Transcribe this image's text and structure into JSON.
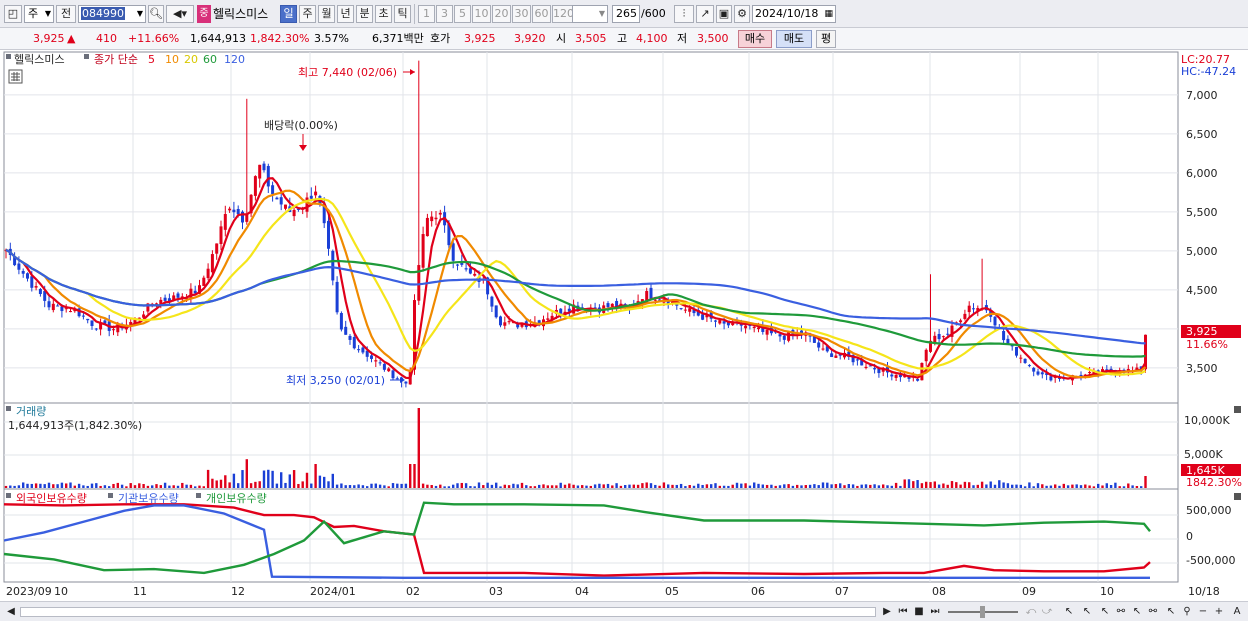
{
  "toolbar": {
    "market_select": "주",
    "prev_label": "전",
    "code": "084990",
    "stock_badge": "중",
    "stock_name": "헬릭스미스",
    "periods": [
      "일",
      "주",
      "월",
      "년",
      "분",
      "초",
      "틱"
    ],
    "active_period": "일",
    "intervals": [
      "1",
      "3",
      "5",
      "10",
      "20",
      "30",
      "60",
      "120"
    ],
    "count": "265",
    "count_total": "/600",
    "date": "2024/10/18"
  },
  "quote": {
    "price": "3,925",
    "change_arrow": "▲",
    "change": "410",
    "change_pct": "+11.66%",
    "volume": "1,644,913",
    "volume_pct": "1,842.30%",
    "turnover_rate": "3.57%",
    "amount": "6,371백만",
    "bid_label": "호가",
    "ask_price": "3,925",
    "bid_price": "3,920",
    "open_label": "시",
    "open": "3,505",
    "high_label": "고",
    "high": "4,100",
    "low_label": "저",
    "low": "3,500",
    "buy_button": "매수",
    "sell_button": "매도",
    "eval_button": "평"
  },
  "price_panel": {
    "title": "헬릭스미스",
    "legend_prefix": "종가 단순",
    "ma_periods": [
      "5",
      "10",
      "20",
      "60",
      "120"
    ],
    "ma_colors": [
      "#e0001a",
      "#f08a00",
      "#f5e51a",
      "#1f9a3a",
      "#3a5fe0"
    ],
    "lc_label": "LC:20.77",
    "hc_label": "HC:-47.24",
    "high_annotation": "최고 7,440 (02/06)",
    "low_annotation": "최저 3,250 (02/01)",
    "dividend_annotation": "배당락(0.00%)",
    "current_price_tag": "3,925",
    "current_pct_tag": "11.66%",
    "y_ticks": [
      "7,000",
      "6,500",
      "6,000",
      "5,500",
      "5,000",
      "4,500",
      "4,000",
      "3,500"
    ]
  },
  "volume_panel": {
    "title": "거래량",
    "value": "1,644,913주(1,842.30%)",
    "y_ticks": [
      "10,000K",
      "5,000K"
    ],
    "current_tag": "1,645K",
    "current_pct": "1842.30%"
  },
  "holders_panel": {
    "legend": [
      "외국인보유수량",
      "기관보유수량",
      "개인보유수량"
    ],
    "legend_colors": [
      "#e0001a",
      "#3a5fe0",
      "#1f9a3a"
    ],
    "y_ticks": [
      "500,000",
      "0",
      "-500,000"
    ]
  },
  "x_axis": {
    "labels": [
      "2023/09",
      "10",
      "11",
      "12",
      "2024/01",
      "02",
      "03",
      "04",
      "05",
      "06",
      "07",
      "08",
      "09",
      "10"
    ],
    "right_label": "10/18"
  },
  "chart_data": {
    "type": "candlestick",
    "title": "헬릭스미스",
    "price_ylim": [
      3050,
      7550
    ],
    "price_points": [
      [
        0,
        5050
      ],
      [
        20,
        4700
      ],
      [
        45,
        4300
      ],
      [
        70,
        4250
      ],
      [
        90,
        4050
      ],
      [
        110,
        4000
      ],
      [
        130,
        4100
      ],
      [
        150,
        4350
      ],
      [
        170,
        4400
      ],
      [
        195,
        4500
      ],
      [
        210,
        5000
      ],
      [
        225,
        5600
      ],
      [
        240,
        5400
      ],
      [
        255,
        6100
      ],
      [
        270,
        5700
      ],
      [
        285,
        5500
      ],
      [
        300,
        5600
      ],
      [
        312,
        5800
      ],
      [
        322,
        5200
      ],
      [
        335,
        4000
      ],
      [
        350,
        3800
      ],
      [
        370,
        3600
      ],
      [
        390,
        3400
      ],
      [
        405,
        3280
      ],
      [
        412,
        4600
      ],
      [
        422,
        5400
      ],
      [
        435,
        5500
      ],
      [
        450,
        4900
      ],
      [
        465,
        4700
      ],
      [
        480,
        4600
      ],
      [
        495,
        4100
      ],
      [
        510,
        4050
      ],
      [
        530,
        4080
      ],
      [
        550,
        4200
      ],
      [
        570,
        4300
      ],
      [
        590,
        4250
      ],
      [
        610,
        4300
      ],
      [
        625,
        4250
      ],
      [
        640,
        4450
      ],
      [
        660,
        4400
      ],
      [
        680,
        4250
      ],
      [
        700,
        4150
      ],
      [
        720,
        4050
      ],
      [
        740,
        4050
      ],
      [
        760,
        3950
      ],
      [
        780,
        3900
      ],
      [
        800,
        3950
      ],
      [
        820,
        3700
      ],
      [
        840,
        3650
      ],
      [
        860,
        3550
      ],
      [
        880,
        3450
      ],
      [
        900,
        3400
      ],
      [
        914,
        3350
      ],
      [
        925,
        3850
      ],
      [
        945,
        3950
      ],
      [
        965,
        4300
      ],
      [
        985,
        4250
      ],
      [
        1000,
        3850
      ],
      [
        1020,
        3600
      ],
      [
        1040,
        3380
      ],
      [
        1060,
        3380
      ],
      [
        1080,
        3400
      ],
      [
        1100,
        3450
      ],
      [
        1120,
        3480
      ],
      [
        1130,
        3450
      ],
      [
        1140,
        3500
      ],
      [
        1146,
        3925
      ]
    ],
    "holders_ylim": [
      -800000,
      700000
    ],
    "holders_series": [
      {
        "name": "외국인보유수량",
        "points": [
          [
            0,
            620000
          ],
          [
            60,
            600000
          ],
          [
            120,
            620000
          ],
          [
            180,
            620000
          ],
          [
            230,
            560000
          ],
          [
            260,
            420000
          ],
          [
            290,
            420000
          ],
          [
            310,
            380000
          ],
          [
            330,
            200000
          ],
          [
            350,
            220000
          ],
          [
            380,
            120000
          ],
          [
            410,
            60000
          ],
          [
            420,
            -650000
          ],
          [
            440,
            -650000
          ],
          [
            520,
            -650000
          ],
          [
            600,
            -700000
          ],
          [
            700,
            -650000
          ],
          [
            800,
            -670000
          ],
          [
            880,
            -650000
          ],
          [
            920,
            -650000
          ],
          [
            960,
            -520000
          ],
          [
            990,
            -600000
          ],
          [
            1040,
            -620000
          ],
          [
            1100,
            -620000
          ],
          [
            1140,
            -550000
          ],
          [
            1146,
            -450000
          ]
        ]
      },
      {
        "name": "기관보유수량",
        "points": [
          [
            0,
            -50000
          ],
          [
            40,
            100000
          ],
          [
            80,
            300000
          ],
          [
            120,
            500000
          ],
          [
            150,
            600000
          ],
          [
            180,
            600000
          ],
          [
            220,
            450000
          ],
          [
            260,
            150000
          ],
          [
            268,
            -720000
          ],
          [
            400,
            -740000
          ],
          [
            600,
            -740000
          ],
          [
            800,
            -740000
          ],
          [
            1000,
            -740000
          ],
          [
            1146,
            -740000
          ]
        ]
      },
      {
        "name": "개인보유수량",
        "points": [
          [
            0,
            -300000
          ],
          [
            50,
            -400000
          ],
          [
            100,
            -600000
          ],
          [
            150,
            -580000
          ],
          [
            200,
            -650000
          ],
          [
            240,
            -500000
          ],
          [
            270,
            -300000
          ],
          [
            300,
            -50000
          ],
          [
            320,
            300000
          ],
          [
            340,
            -100000
          ],
          [
            380,
            120000
          ],
          [
            410,
            60000
          ],
          [
            420,
            650000
          ],
          [
            450,
            620000
          ],
          [
            520,
            620000
          ],
          [
            600,
            600000
          ],
          [
            640,
            480000
          ],
          [
            700,
            320000
          ],
          [
            800,
            320000
          ],
          [
            880,
            280000
          ],
          [
            940,
            250000
          ],
          [
            980,
            230000
          ],
          [
            1040,
            280000
          ],
          [
            1100,
            300000
          ],
          [
            1140,
            260000
          ],
          [
            1146,
            120000
          ]
        ]
      }
    ]
  }
}
